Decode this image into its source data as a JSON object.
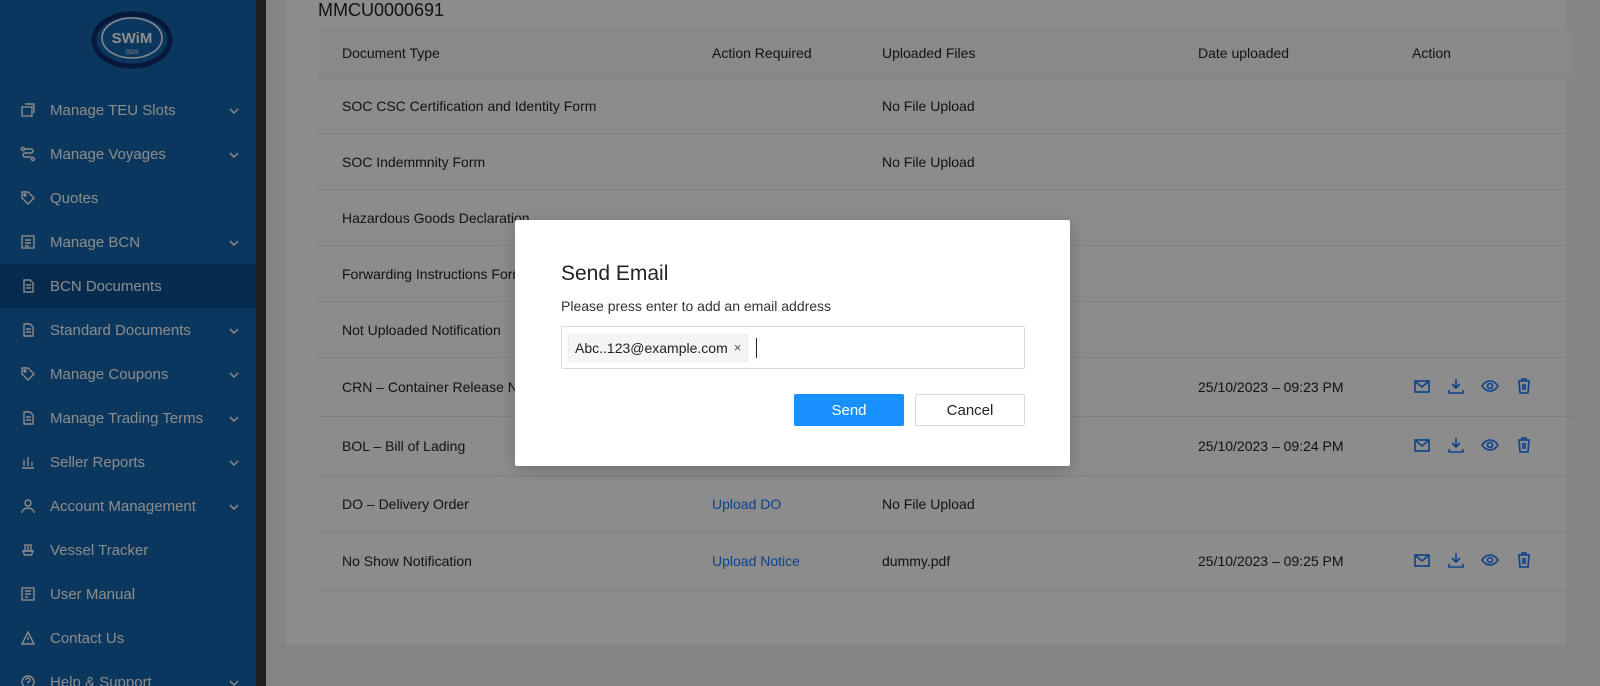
{
  "sidebar": {
    "logo_text": "SWiM",
    "logo_sub": "GDS",
    "items": [
      {
        "label": "Manage TEU Slots",
        "icon": "stack-icon",
        "has_chevron": true,
        "active": false
      },
      {
        "label": "Manage Voyages",
        "icon": "route-icon",
        "has_chevron": true,
        "active": false
      },
      {
        "label": "Quotes",
        "icon": "tag-icon",
        "has_chevron": false,
        "active": false
      },
      {
        "label": "Manage BCN",
        "icon": "list-icon",
        "has_chevron": true,
        "active": false
      },
      {
        "label": "BCN Documents",
        "icon": "document-icon",
        "has_chevron": false,
        "active": true
      },
      {
        "label": "Standard Documents",
        "icon": "document-icon",
        "has_chevron": true,
        "active": false
      },
      {
        "label": "Manage Coupons",
        "icon": "tag-icon",
        "has_chevron": true,
        "active": false
      },
      {
        "label": "Manage Trading Terms",
        "icon": "document-icon",
        "has_chevron": true,
        "active": false
      },
      {
        "label": "Seller Reports",
        "icon": "bar-chart-icon",
        "has_chevron": true,
        "active": false
      },
      {
        "label": "Account Management",
        "icon": "user-icon",
        "has_chevron": true,
        "active": false
      },
      {
        "label": "Vessel Tracker",
        "icon": "ship-icon",
        "has_chevron": false,
        "active": false
      },
      {
        "label": "User Manual",
        "icon": "book-icon",
        "has_chevron": false,
        "active": false
      },
      {
        "label": "Contact Us",
        "icon": "warning-icon",
        "has_chevron": false,
        "active": false
      },
      {
        "label": "Help & Support",
        "icon": "help-icon",
        "has_chevron": true,
        "active": false
      }
    ]
  },
  "main": {
    "bcn_id": "MMCU0000691",
    "columns": [
      "Document Type",
      "Action Required",
      "Uploaded Files",
      "Date uploaded",
      "Action"
    ],
    "rows": [
      {
        "doc": "SOC CSC Certification and Identity Form",
        "action": "",
        "file": "No File Upload",
        "date": "",
        "icons": false,
        "h": 55
      },
      {
        "doc": "SOC Indemmnity Form",
        "action": "",
        "file": "No File Upload",
        "date": "",
        "icons": false,
        "h": 56
      },
      {
        "doc": "Hazardous Goods Declaration",
        "action": "",
        "file": "",
        "date": "",
        "icons": false,
        "h": 56
      },
      {
        "doc": "Forwarding Instructions Form",
        "action": "",
        "file": "",
        "date": "",
        "icons": false,
        "h": 56
      },
      {
        "doc": "Not Uploaded Notification",
        "action": "",
        "file": "",
        "date": "",
        "icons": false,
        "h": 56
      },
      {
        "doc": "CRN – Container Release Notice",
        "action": "",
        "file": "",
        "date": "25/10/2023 – 09:23 PM",
        "icons": true,
        "h": 59
      },
      {
        "doc": "BOL – Bill of Lading",
        "action": "",
        "file": "",
        "date": "25/10/2023 – 09:24 PM",
        "icons": true,
        "h": 59
      },
      {
        "doc": "DO – Delivery Order",
        "action": "Upload DO",
        "file": "No File Upload",
        "date": "",
        "icons": false,
        "h": 56
      },
      {
        "doc": "No Show Notification",
        "action": "Upload Notice",
        "file": "dummy.pdf",
        "date": "25/10/2023 – 09:25 PM",
        "icons": true,
        "h": 59
      }
    ]
  },
  "modal": {
    "title": "Send Email",
    "description": "Please press enter to add an email address",
    "email_tag": "Abc..123@example.com",
    "tag_close": "×",
    "send_label": "Send",
    "cancel_label": "Cancel"
  },
  "colors": {
    "sidebar_bg": "#1565ad",
    "sidebar_active": "#0e4f8f",
    "primary": "#1890ff",
    "link": "#1677ff"
  }
}
